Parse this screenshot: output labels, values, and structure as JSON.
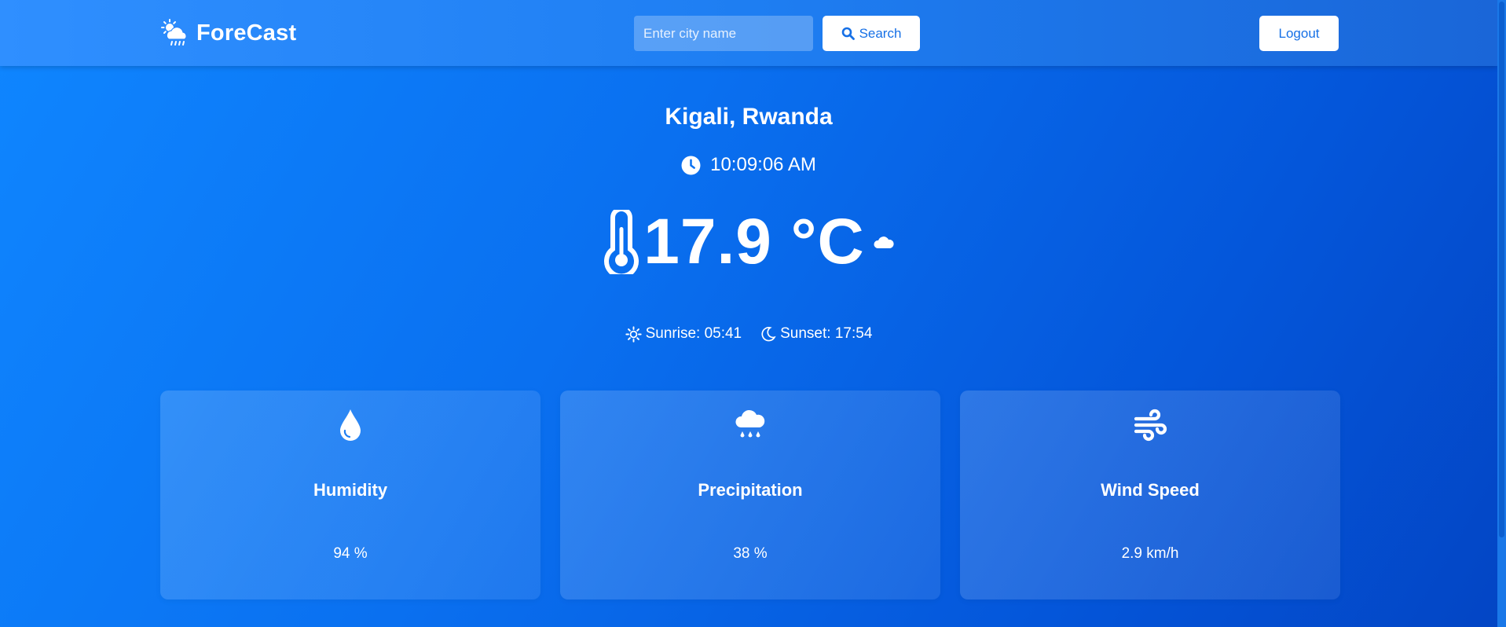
{
  "app": {
    "brand": "ForeCast",
    "brand_icon": "cloud-sun-rain-icon"
  },
  "search": {
    "placeholder": "Enter city name",
    "value": "",
    "button_label": "Search",
    "button_icon": "search-icon"
  },
  "logout": {
    "label": "Logout"
  },
  "location": {
    "city": "Kigali, Rwanda"
  },
  "time": {
    "value": "10:09:06 AM",
    "icon": "clock-icon"
  },
  "temperature": {
    "value": "17.9 °C",
    "icon": "thermometer-icon",
    "condition_icon": "cloud-icon"
  },
  "sun": {
    "sunrise": {
      "label": "Sunrise: 05:41",
      "icon": "sun-icon"
    },
    "sunset": {
      "label": "Sunset: 17:54",
      "icon": "moon-icon"
    }
  },
  "cards": [
    {
      "title": "Humidity",
      "value": "94 %",
      "icon": "droplet-icon"
    },
    {
      "title": "Precipitation",
      "value": "38 %",
      "icon": "cloud-rain-icon"
    },
    {
      "title": "Wind Speed",
      "value": "2.9 km/h",
      "icon": "wind-icon"
    }
  ],
  "colors": {
    "accent": "#1670e6",
    "background_start": "#0f86ff",
    "background_end": "#0345c4"
  }
}
